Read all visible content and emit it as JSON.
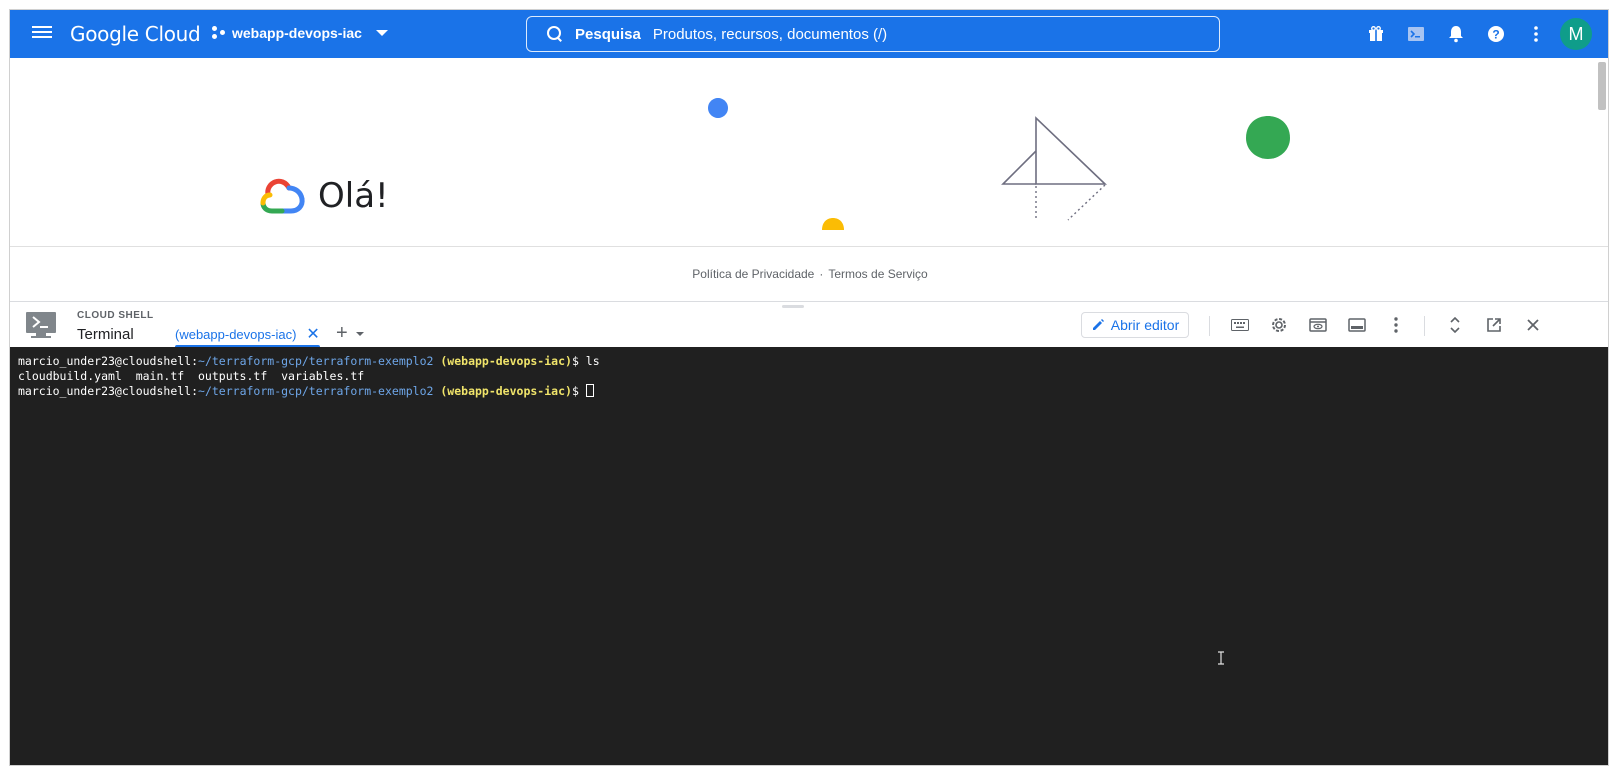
{
  "topbar": {
    "brand": "Google Cloud",
    "project": "webapp-devops-iac",
    "search_label": "Pesquisa",
    "search_placeholder": "Produtos, recursos, documentos (/)",
    "avatar_letter": "M",
    "icons": [
      "gift-icon",
      "cloud-shell-icon",
      "notifications-icon",
      "help-icon",
      "more-vert-icon"
    ]
  },
  "hero": {
    "greeting": "Olá!"
  },
  "footer": {
    "privacy": "Política de Privacidade",
    "separator": "·",
    "terms": "Termos de Serviço"
  },
  "shell": {
    "small_title": "CLOUD SHELL",
    "title": "Terminal",
    "tab_label": "(webapp-devops-iac)",
    "tab_close": "✕",
    "add_tab": "+",
    "open_editor": "Abrir editor"
  },
  "terminal": {
    "lines": [
      {
        "user": "marcio_under23@cloudshell",
        "colon": ":",
        "path": "~/terraform-gcp/terraform-exemplo2",
        "project": "(webapp-devops-iac)",
        "prompt": "$ ",
        "cmd": "ls"
      },
      {
        "output": "cloudbuild.yaml  main.tf  outputs.tf  variables.tf"
      },
      {
        "user": "marcio_under23@cloudshell",
        "colon": ":",
        "path": "~/terraform-gcp/terraform-exemplo2",
        "project": "(webapp-devops-iac)",
        "prompt": "$ ",
        "cmd": ""
      }
    ]
  },
  "colors": {
    "topbar": "#1a73e8",
    "terminal_bg": "#202020",
    "path": "#6ea6e8",
    "project": "#f0e46a",
    "avatar": "#0f9d8a"
  }
}
